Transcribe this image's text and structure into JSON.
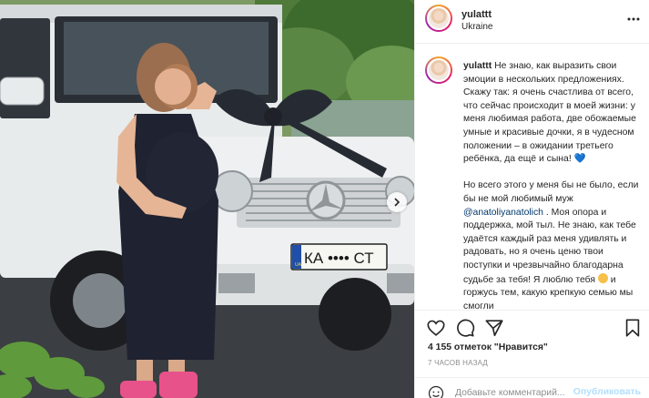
{
  "post": {
    "username": "yulattt",
    "location": "Ukraine"
  },
  "plate": {
    "country": "UA",
    "text": "КА •••• СТ"
  },
  "caption": {
    "username": "yulattt",
    "p1": "Не знаю, как выразить свои эмоции в нескольких предложениях. Скажу так: я очень счастлива от всего, что сейчас происходит в моей жизни: у меня любимая работа, две обожаемые умные и красивые дочки, я в чудесном положении – в ожидании третьего ребёнка, да ещё и сына! ",
    "p1_emoji": "💙",
    "p2_start": "Но всего этого у меня бы не было, если бы не мой любимый муж ",
    "mention": "@anatoliyanatolich",
    "p2_mid": " . Моя опора и поддержка, мой тыл. Не знаю, как тебе удаётся каждый раз меня удивлять и радовать, но я очень ценю твои поступки и чрезвычайно благодарна судьбе за тебя! Я люблю тебя ",
    "p2_end": " и горжусь тем, какую крепкую семью мы смогли"
  },
  "likes_text": "4 155 отметок \"Нравится\"",
  "time_ago": "7 ЧАСОВ НАЗАД",
  "comment": {
    "placeholder": "Добавьте комментарий...",
    "publish_label": "Опубликовать"
  },
  "colors": {
    "mention": "#00376b",
    "publish_disabled": "#b2dffc",
    "muted": "#8e8e8e"
  },
  "icons": [
    "more-horizontal-icon",
    "heart-icon",
    "comment-icon",
    "share-icon",
    "bookmark-icon",
    "emoji-icon",
    "chevron-right-icon"
  ]
}
